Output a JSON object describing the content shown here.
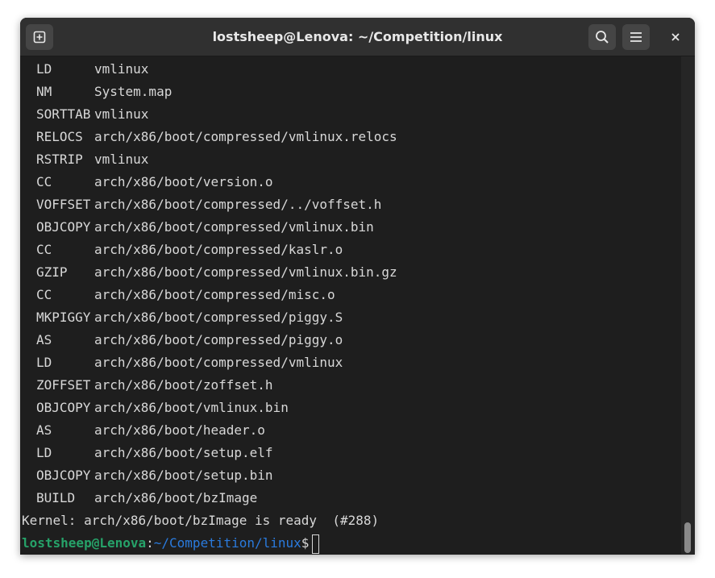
{
  "window": {
    "title": "lostsheep@Lenova: ~/Competition/linux",
    "buttons": {
      "new_tab_icon": "new-tab-icon",
      "search_icon": "search-icon",
      "menu_icon": "hamburger-menu-icon",
      "close_icon": "close-icon"
    }
  },
  "terminal": {
    "build_lines": [
      {
        "cmd": "LD",
        "path": "vmlinux"
      },
      {
        "cmd": "NM",
        "path": "System.map"
      },
      {
        "cmd": "SORTTAB",
        "path": "vmlinux"
      },
      {
        "cmd": "RELOCS",
        "path": "arch/x86/boot/compressed/vmlinux.relocs"
      },
      {
        "cmd": "RSTRIP",
        "path": "vmlinux"
      },
      {
        "cmd": "CC",
        "path": "arch/x86/boot/version.o"
      },
      {
        "cmd": "VOFFSET",
        "path": "arch/x86/boot/compressed/../voffset.h"
      },
      {
        "cmd": "OBJCOPY",
        "path": "arch/x86/boot/compressed/vmlinux.bin"
      },
      {
        "cmd": "CC",
        "path": "arch/x86/boot/compressed/kaslr.o"
      },
      {
        "cmd": "GZIP",
        "path": "arch/x86/boot/compressed/vmlinux.bin.gz"
      },
      {
        "cmd": "CC",
        "path": "arch/x86/boot/compressed/misc.o"
      },
      {
        "cmd": "MKPIGGY",
        "path": "arch/x86/boot/compressed/piggy.S"
      },
      {
        "cmd": "AS",
        "path": "arch/x86/boot/compressed/piggy.o"
      },
      {
        "cmd": "LD",
        "path": "arch/x86/boot/compressed/vmlinux"
      },
      {
        "cmd": "ZOFFSET",
        "path": "arch/x86/boot/zoffset.h"
      },
      {
        "cmd": "OBJCOPY",
        "path": "arch/x86/boot/vmlinux.bin"
      },
      {
        "cmd": "AS",
        "path": "arch/x86/boot/header.o"
      },
      {
        "cmd": "LD",
        "path": "arch/x86/boot/setup.elf"
      },
      {
        "cmd": "OBJCOPY",
        "path": "arch/x86/boot/setup.bin"
      },
      {
        "cmd": "BUILD",
        "path": "arch/x86/boot/bzImage"
      }
    ],
    "kernel_line": "Kernel: arch/x86/boot/bzImage is ready  (#288)",
    "prompt": {
      "user_host": "lostsheep@Lenova",
      "colon": ":",
      "dir": "~/Competition/linux",
      "dollar": "$"
    }
  },
  "colors": {
    "prompt_user": "#26a269",
    "prompt_dir": "#2a7bde",
    "background": "#1e1e1e",
    "titlebar": "#303030"
  }
}
